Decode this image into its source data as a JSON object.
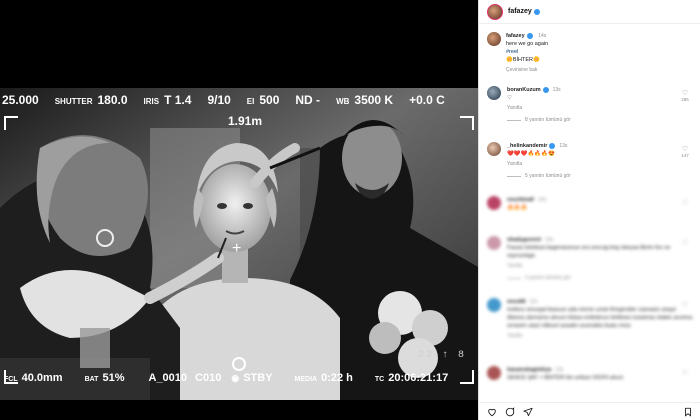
{
  "hud": {
    "top": [
      {
        "label": "",
        "value": "25.000"
      },
      {
        "label": "SHUTTER",
        "value": "180.0"
      },
      {
        "label": "IRIS",
        "value": "T 1.4"
      },
      {
        "label": "",
        "value": "9/10"
      },
      {
        "label": "EI",
        "value": "500"
      },
      {
        "label": "",
        "value": "ND -"
      },
      {
        "label": "WB",
        "value": "3500 K"
      },
      {
        "label": "",
        "value": "+0.0 C"
      }
    ],
    "distance": "1.91m",
    "bottom": {
      "focal_label": "FCL",
      "focal_value": "40.0mm",
      "bat_label": "BAT",
      "bat_value": "51%",
      "clip": "A_0010",
      "card": "C010",
      "standby": "STBY",
      "media_label": "MEDIA",
      "media_value": "0:22 h",
      "tc_label": "TC",
      "tc_value": "20:06:21:17"
    },
    "frame_counter": "23 ↑ 8"
  },
  "panel": {
    "username": "fafazey",
    "caption": {
      "username": "fafazey",
      "time": "14s",
      "line1": "here we go again",
      "line2": "#reel",
      "line3": "🌼BİHTER🌼",
      "see_translation": "Çevirisine bak"
    },
    "comments": [
      {
        "username": "boranKuzum",
        "time": "13s",
        "text": "♡",
        "reply": "Yanıtla",
        "view_replies": "8 yanıtın tümünü gör",
        "likes": "285",
        "blurred": false
      },
      {
        "username": "_helinkandemir",
        "time": "13s",
        "text": "❤️❤️❤️🔥🔥🔥😍",
        "reply": "Yanıtla",
        "view_replies": "5 yanıtın tümünü gör",
        "likes": "147",
        "blurred": false
      },
      {
        "username": "nourbtoall",
        "time": "14s",
        "text": "🔥🔥🔥",
        "reply": "",
        "view_replies": "",
        "likes": "",
        "blurred": true
      },
      {
        "username": "shadyguvent",
        "time": "13s",
        "text": "Fazasi tebrikasi bagenasonun era sevcag beg obeyaa fikrim fon ne vaynunlage",
        "reply": "Yanıtla",
        "view_replies": "3 yanıtın tümünü gör",
        "likes": "",
        "blurred": true
      },
      {
        "username": "nevs66",
        "time": "12s",
        "text": "mellors ümurgal ikasuun ada mirme ucluk firingeniiler ciamasin sioqul dilanea alsmama uleuun kilasa eoldulerun birikkaru tusiamas islakin arumna urnaoirn aiazi nilbiunl asaalei usumakla ituaiu miza",
        "reply": "Yanıtla",
        "view_replies": "",
        "likes": "",
        "blurred": true
      },
      {
        "username": "hasanubagiekiya",
        "time": "13s",
        "text": "SENCE ŞAY + BİHTER bin sefaze 2024'li aloun",
        "reply": "",
        "view_replies": "",
        "likes": "",
        "blurred": true
      }
    ]
  },
  "colors": {
    "accent": "#3897f0",
    "muted": "#8e8e8e",
    "heart_red": "#ed4956"
  }
}
